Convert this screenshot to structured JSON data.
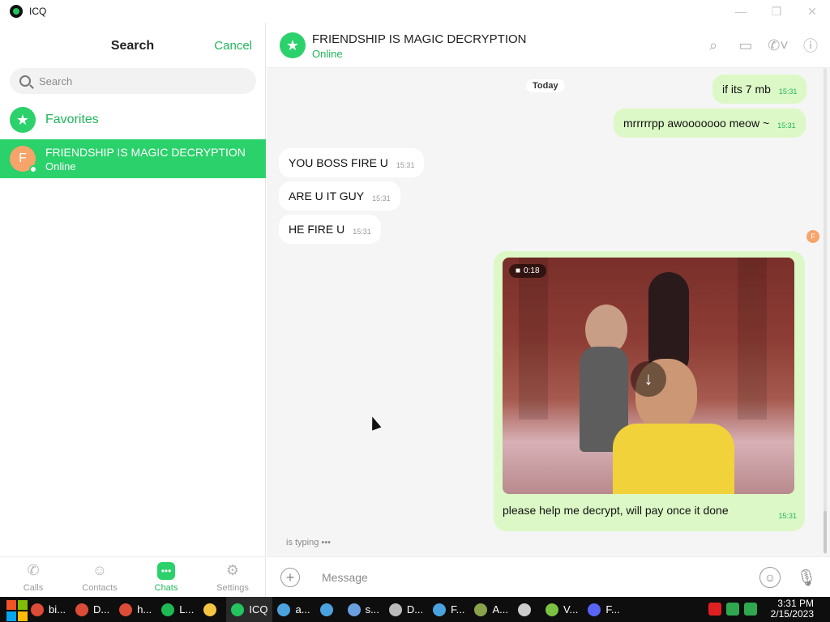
{
  "window": {
    "title": "ICQ",
    "minimize": "—",
    "restore": "❐",
    "close": "✕"
  },
  "sidebar": {
    "header_title": "Search",
    "cancel_label": "Cancel",
    "search_placeholder": "Search",
    "favorites_label": "Favorites",
    "chat_item": {
      "avatar_letter": "F",
      "name": "FRIENDSHIP IS MAGIC DECRYPTION",
      "status": "Online"
    },
    "nav": [
      {
        "label": "Calls",
        "icon": "phone-icon"
      },
      {
        "label": "Contacts",
        "icon": "contacts-icon"
      },
      {
        "label": "Chats",
        "icon": "chats-icon"
      },
      {
        "label": "Settings",
        "icon": "settings-icon"
      }
    ]
  },
  "chat": {
    "name": "FRIENDSHIP IS MAGIC DECRYPTION",
    "status": "Online",
    "date_divider": "Today",
    "messages": [
      {
        "dir": "out",
        "text": "if its 7 mb",
        "time": "15:31"
      },
      {
        "dir": "out",
        "text": "mrrrrrpp awooooooo meow ~",
        "time": "15:31"
      },
      {
        "dir": "in",
        "text": "YOU BOSS FIRE U",
        "time": "15:31"
      },
      {
        "dir": "in",
        "text": "ARE U IT GUY",
        "time": "15:31"
      },
      {
        "dir": "in",
        "text": "HE FIRE U",
        "time": "15:31"
      }
    ],
    "media": {
      "duration": "0:18",
      "caption": "please help me decrypt, will pay once it done",
      "time": "15:31"
    },
    "reaction_avatar_letter": "F",
    "typing_text": "is typing •••",
    "input_placeholder": "Message"
  },
  "taskbar": {
    "items": [
      {
        "label": "bi...",
        "color": "#dd4b39"
      },
      {
        "label": "D...",
        "color": "#dd4b39"
      },
      {
        "label": "h...",
        "color": "#dd4b39"
      },
      {
        "label": "L...",
        "color": "#1db954"
      },
      {
        "label": "",
        "color": "#f5c542"
      },
      {
        "label": "ICQ",
        "color": "#22c55e"
      },
      {
        "label": "a...",
        "color": "#4aa3df"
      },
      {
        "label": "",
        "color": "#4aa3df"
      },
      {
        "label": "s...",
        "color": "#6aa0e0"
      },
      {
        "label": "D...",
        "color": "#bbbbbb"
      },
      {
        "label": "F...",
        "color": "#4aa3df"
      },
      {
        "label": "A...",
        "color": "#8aa34a"
      },
      {
        "label": "",
        "color": "#cccccc"
      },
      {
        "label": "V...",
        "color": "#7cc242"
      },
      {
        "label": "F...",
        "color": "#5865f2"
      }
    ],
    "time": "3:31 PM",
    "date": "2/15/2023"
  }
}
